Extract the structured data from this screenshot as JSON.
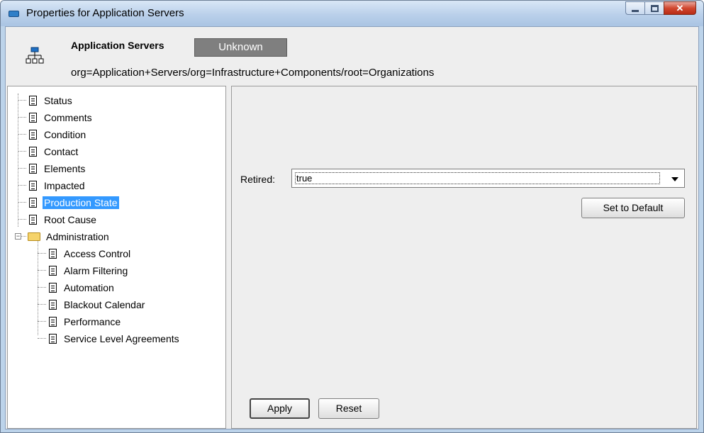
{
  "window": {
    "title": "Properties for Application Servers"
  },
  "header": {
    "name": "Application Servers",
    "status": "Unknown",
    "path": "org=Application+Servers/org=Infrastructure+Components/root=Organizations"
  },
  "tree": {
    "items": [
      {
        "label": "Status"
      },
      {
        "label": "Comments"
      },
      {
        "label": "Condition"
      },
      {
        "label": "Contact"
      },
      {
        "label": "Elements"
      },
      {
        "label": "Impacted"
      },
      {
        "label": "Production State",
        "selected": true
      },
      {
        "label": "Root Cause"
      }
    ],
    "folder": {
      "label": "Administration",
      "expanded": true,
      "children": [
        {
          "label": "Access Control"
        },
        {
          "label": "Alarm Filtering"
        },
        {
          "label": "Automation"
        },
        {
          "label": "Blackout Calendar"
        },
        {
          "label": "Performance"
        },
        {
          "label": "Service Level Agreements"
        }
      ]
    }
  },
  "form": {
    "retired_label": "Retired:",
    "retired_value": "true",
    "set_default_label": "Set to Default",
    "apply_label": "Apply",
    "reset_label": "Reset"
  },
  "colors": {
    "selection": "#3399ff",
    "status_badge": "#7f7f7f"
  }
}
